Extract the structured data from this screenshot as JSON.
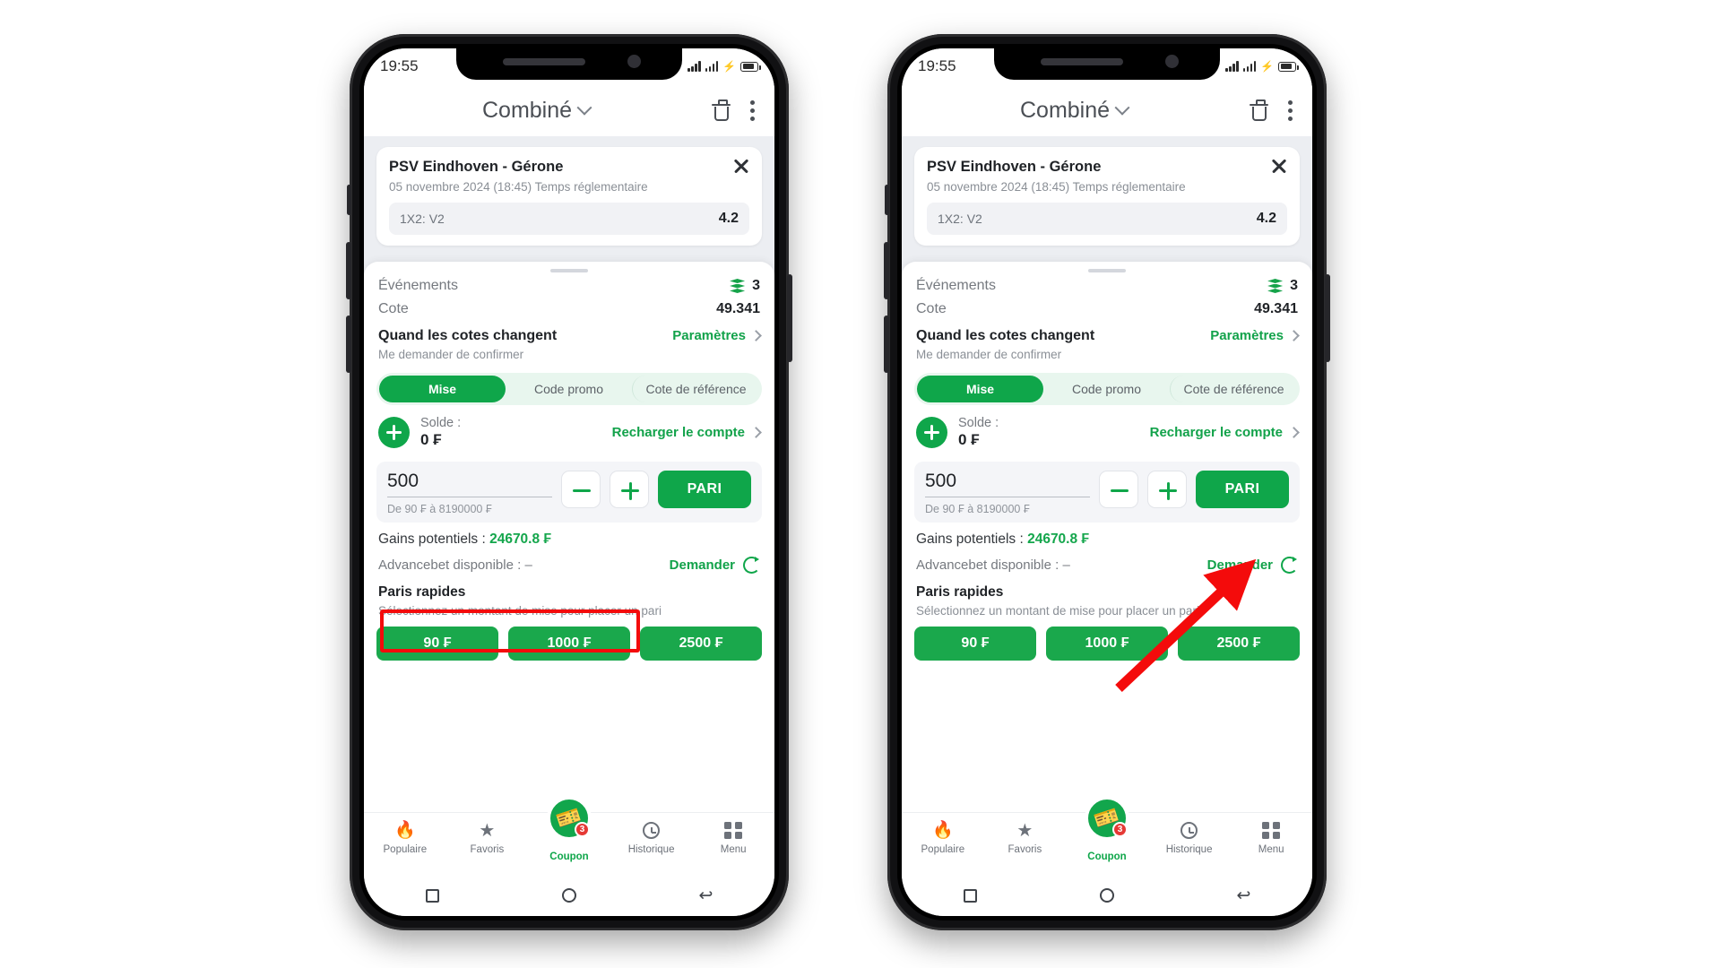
{
  "meta": {
    "accent_green": "#0fa64a",
    "annotation_red": "#f40b0b",
    "phones": 2
  },
  "status_bar": {
    "time": "19:55"
  },
  "header": {
    "title": "Combiné",
    "chevron_icon": "chevron-down-icon",
    "delete_icon": "trash-icon",
    "menu_icon": "kebab-menu-icon"
  },
  "event_card": {
    "title": "PSV Eindhoven - Gérone",
    "subtitle": "05 novembre 2024 (18:45) Temps réglementaire",
    "selection_label": "1X2: V2",
    "selection_odd": "4.2",
    "close_icon": "close-icon"
  },
  "summary": {
    "events_label": "Événements",
    "events_count": "3",
    "events_icon": "layers-icon",
    "odds_label": "Cote",
    "odds_value": "49.341"
  },
  "odds_change": {
    "title": "Quand les cotes changent",
    "subtitle": "Me demander de confirmer",
    "settings_label": "Paramètres",
    "chevron_icon": "chevron-right-icon"
  },
  "segments": [
    {
      "label": "Mise",
      "active": true
    },
    {
      "label": "Code promo",
      "active": false
    },
    {
      "label": "Cote de référence",
      "active": false
    }
  ],
  "balance": {
    "add_icon": "plus-circle-icon",
    "label": "Solde :",
    "amount": "0 ₣",
    "topup_label": "Recharger le compte",
    "chevron_icon": "chevron-right-icon"
  },
  "stake": {
    "value": "500",
    "hint": "De 90 ₣ à 8190000 ₣",
    "minus_icon": "minus-icon",
    "plus_icon": "plus-icon",
    "bet_button": "PARI"
  },
  "potential": {
    "label": "Gains potentiels : ",
    "value": "24670.8 ₣"
  },
  "advancebet": {
    "label": "Advancebet disponible : –",
    "action_label": "Demander",
    "refresh_icon": "refresh-icon"
  },
  "quick_bets": {
    "title": "Paris rapides",
    "subtitle": "Sélectionnez un montant de mise pour placer un pari",
    "amounts": [
      "90 ₣",
      "1000 ₣",
      "2500 ₣"
    ]
  },
  "tabbar": [
    {
      "label": "Populaire",
      "icon": "fire-icon",
      "active": false
    },
    {
      "label": "Favoris",
      "icon": "star-icon",
      "active": false
    },
    {
      "label": "Coupon",
      "icon": "ticket-icon",
      "active": true,
      "badge": "3"
    },
    {
      "label": "Historique",
      "icon": "clock-icon",
      "active": false
    },
    {
      "label": "Menu",
      "icon": "grid-icon",
      "active": false
    }
  ],
  "android_nav": {
    "recents_icon": "square-icon",
    "home_icon": "circle-icon",
    "back_icon": "back-arrow-icon"
  },
  "annotations": {
    "left_highlight_target": "potential-gains-row",
    "right_arrow_target": "bet-button"
  }
}
